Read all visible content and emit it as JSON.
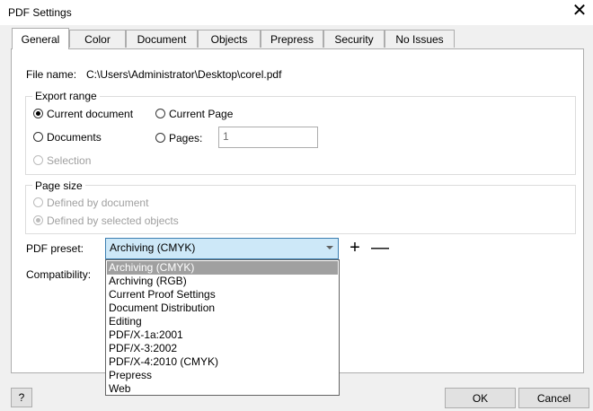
{
  "window": {
    "title": "PDF Settings",
    "close_glyph": "✕"
  },
  "tabs": [
    {
      "label": "General"
    },
    {
      "label": "Color"
    },
    {
      "label": "Document"
    },
    {
      "label": "Objects"
    },
    {
      "label": "Prepress"
    },
    {
      "label": "Security"
    },
    {
      "label": "No Issues"
    }
  ],
  "file": {
    "label": "File name:",
    "value": "C:\\Users\\Administrator\\Desktop\\corel.pdf"
  },
  "export_range": {
    "legend": "Export range",
    "current_document": "Current document",
    "current_page": "Current Page",
    "documents": "Documents",
    "pages": "Pages:",
    "pages_value": "1",
    "selection": "Selection"
  },
  "page_size": {
    "legend": "Page size",
    "defined_by_document": "Defined by document",
    "defined_by_selected": "Defined by selected objects"
  },
  "preset": {
    "label": "PDF preset:",
    "value": "Archiving (CMYK)",
    "plus_glyph": "+",
    "minus_glyph": "—",
    "options": [
      "Archiving (CMYK)",
      "Archiving (RGB)",
      "Current Proof Settings",
      "Document Distribution",
      "Editing",
      "PDF/X-1a:2001",
      "PDF/X-3:2002",
      "PDF/X-4:2010 (CMYK)",
      "Prepress",
      "Web"
    ]
  },
  "compatibility": {
    "label": "Compatibility:"
  },
  "buttons": {
    "help": "?",
    "ok": "OK",
    "cancel": "Cancel"
  },
  "icons": {
    "close": "close-icon",
    "plus": "plus-icon",
    "minus": "minus-icon",
    "dropdown": "chevron-down-icon"
  }
}
